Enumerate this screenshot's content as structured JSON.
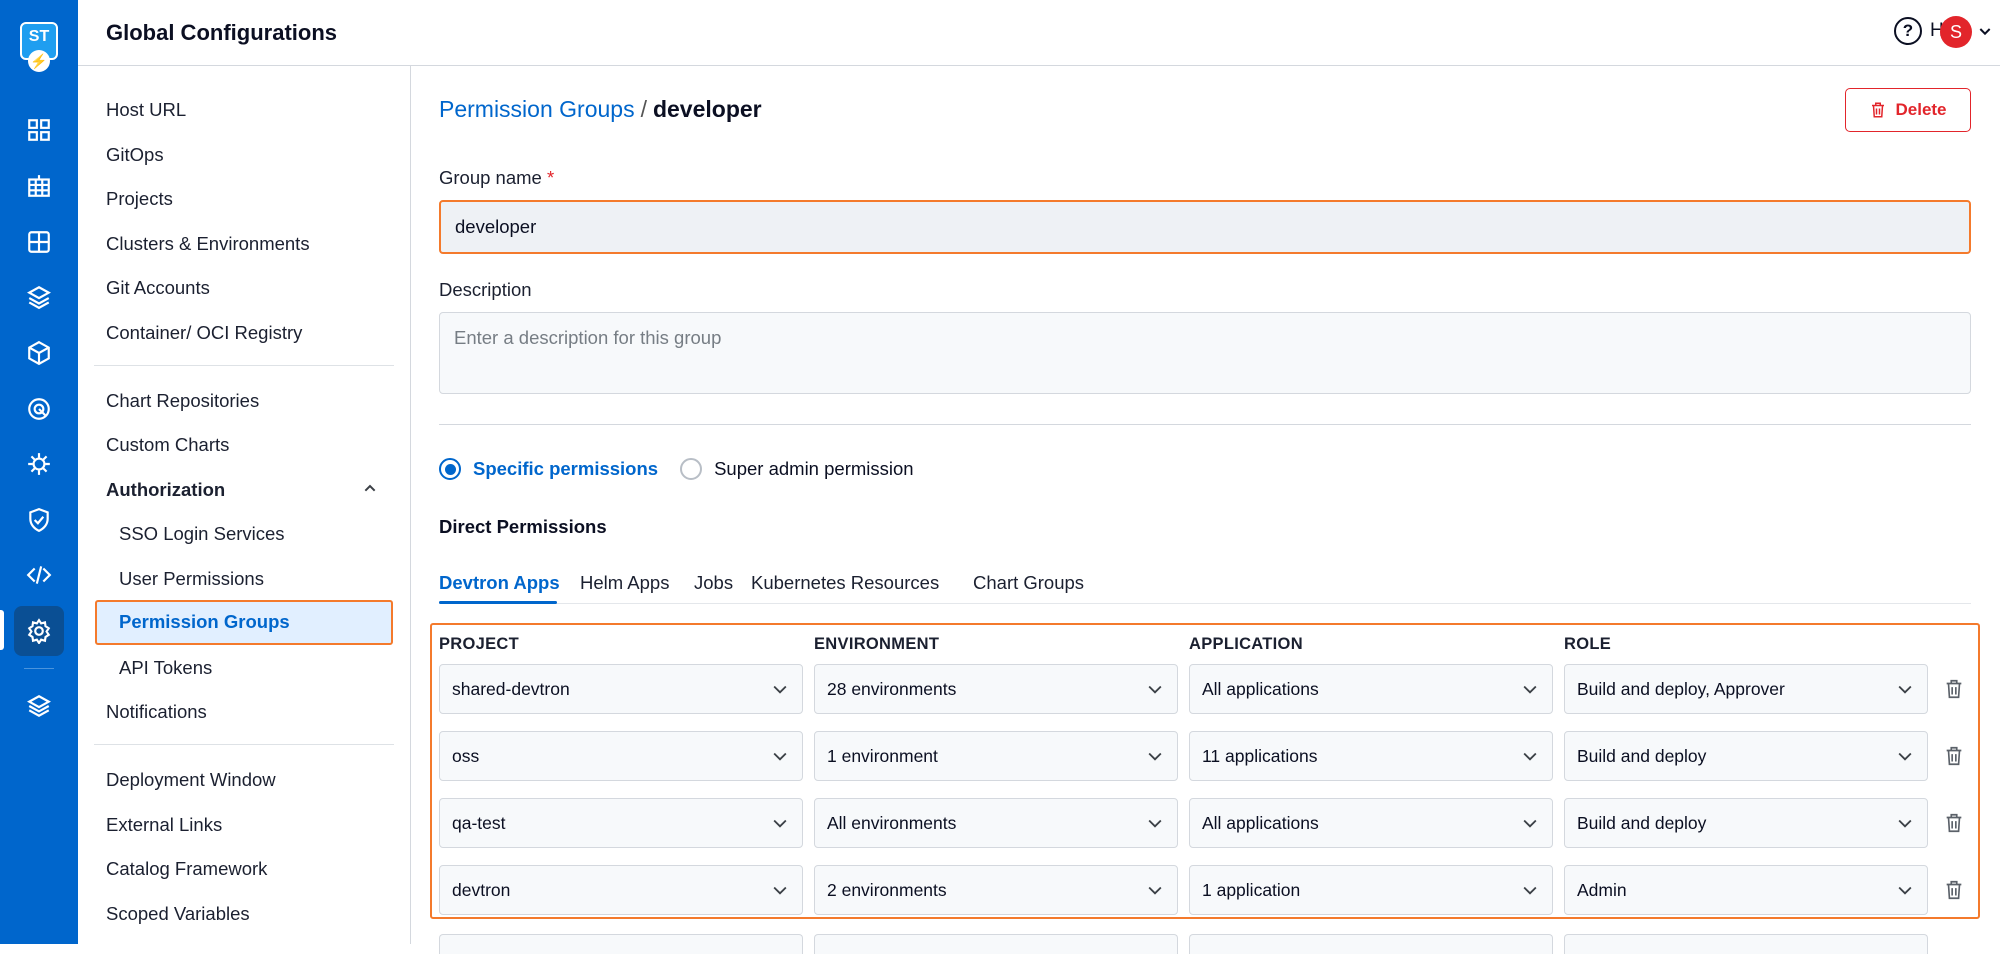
{
  "rail": {
    "logo_text": "ST",
    "icons": [
      "app-grid-icon",
      "chart-store-icon",
      "resource-grid-icon",
      "stack-icon",
      "cube-icon",
      "security-target-icon",
      "bug-icon",
      "shield-check-icon",
      "code-icon",
      "settings-gear-icon",
      "layers-icon"
    ]
  },
  "header": {
    "title": "Global Configurations",
    "help_label": "Help",
    "avatar_initial": "S"
  },
  "sidebar": {
    "items": [
      "Host URL",
      "GitOps",
      "Projects",
      "Clusters & Environments",
      "Git Accounts",
      "Container/ OCI Registry",
      "Chart Repositories",
      "Custom Charts",
      "Authorization",
      "SSO Login Services",
      "User Permissions",
      "Permission Groups",
      "API Tokens",
      "Notifications",
      "Deployment Window",
      "External Links",
      "Catalog Framework",
      "Scoped Variables"
    ],
    "selected": "Permission Groups"
  },
  "breadcrumb": {
    "parent": "Permission Groups",
    "separator": "/",
    "current": "developer"
  },
  "actions": {
    "delete_label": "Delete"
  },
  "form": {
    "group_name_label": "Group name",
    "required_mark": "*",
    "group_name_value": "developer",
    "description_label": "Description",
    "description_placeholder": "Enter a description for this group"
  },
  "permission_type": {
    "options": [
      "Specific permissions",
      "Super admin permission"
    ],
    "selected": "Specific permissions"
  },
  "direct_permissions": {
    "heading": "Direct Permissions",
    "tabs": [
      "Devtron Apps",
      "Helm Apps",
      "Jobs",
      "Kubernetes Resources",
      "Chart Groups"
    ],
    "active_tab": "Devtron Apps",
    "columns": [
      "PROJECT",
      "ENVIRONMENT",
      "APPLICATION",
      "ROLE"
    ],
    "rows": [
      [
        "shared-devtron",
        "28 environments",
        "All applications",
        "Build and deploy, Approver"
      ],
      [
        "oss",
        "1 environment",
        "11 applications",
        "Build and deploy"
      ],
      [
        "qa-test",
        "All environments",
        "All applications",
        "Build and deploy"
      ],
      [
        "devtron",
        "2 environments",
        "1 application",
        "Admin"
      ]
    ]
  },
  "colors": {
    "accent": "#0066cc",
    "highlight": "#f47a2c",
    "danger": "#e2252b",
    "rail": "#0066cc"
  }
}
